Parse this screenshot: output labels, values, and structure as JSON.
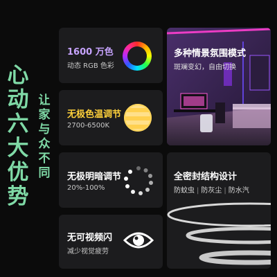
{
  "hero": {
    "chars": [
      "心",
      "动",
      "六",
      "大",
      "优",
      "势"
    ],
    "sub_chars": [
      "让",
      "家",
      "与",
      "众",
      "不",
      "同"
    ]
  },
  "cards": {
    "color": {
      "title": "1600 万色",
      "subtitle": "动态 RGB 色彩"
    },
    "temp": {
      "title": "无极色温调节",
      "subtitle": "2700-6500K"
    },
    "brightness": {
      "title": "无极明暗调节",
      "subtitle": "20%-100%"
    },
    "flicker": {
      "title": "无可视频闪",
      "subtitle": "减少视觉疲劳"
    }
  },
  "scene": {
    "title": "多种情景氛围模式",
    "subtitle": "斑斓变幻，自由切换"
  },
  "seal": {
    "title": "全密封结构设计",
    "tags": [
      "防蚊虫",
      "防灰尘",
      "防水汽"
    ]
  },
  "colors": {
    "accent_green": "#7fd9a6",
    "card_bg": "#1c1c1e",
    "page_bg": "#0b0b0b",
    "temp_highlight": "#ffd13b"
  }
}
